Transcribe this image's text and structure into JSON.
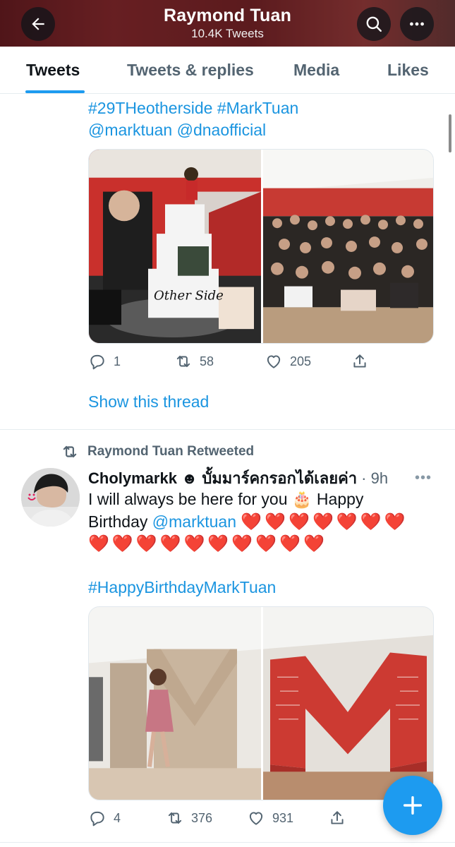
{
  "header": {
    "title": "Raymond Tuan",
    "subtitle": "10.4K Tweets",
    "back_icon": "back-arrow-icon",
    "search_icon": "search-icon",
    "more_icon": "more-icon"
  },
  "tabs": [
    {
      "label": "Tweets",
      "active": true
    },
    {
      "label": "Tweets & replies",
      "active": false
    },
    {
      "label": "Media",
      "active": false
    },
    {
      "label": "Likes",
      "active": false
    }
  ],
  "tweet1": {
    "hashtags_line": "#29THeotherside #MarkTuan",
    "mentions_line": "@marktuan @dnaofficial",
    "actions": {
      "reply": "1",
      "retweet": "58",
      "like": "205"
    },
    "show_thread": "Show this thread"
  },
  "tweet2": {
    "retweeted_by": "Raymond Tuan Retweeted",
    "display_name": "Cholymarkk ☻ บั้มมาร์คกรอกได้เลยค่า",
    "time": "· 9h",
    "line1": "I will always be here for you 🎂  Happy",
    "line2_prefix": "Birthday ",
    "mention": "@marktuan",
    "hearts_line2": "❤️❤️❤️❤️❤️❤️❤️",
    "hearts_line3": "❤️❤️❤️❤️❤️❤️❤️❤️❤️❤️",
    "hashtag": "#HappyBirthdayMarkTuan",
    "actions": {
      "reply": "4",
      "retweet": "376",
      "like": "931"
    }
  },
  "fab": {
    "icon": "compose-plus-icon"
  },
  "colors": {
    "accent": "#1d9bf0",
    "text": "#0f1419",
    "muted": "#536471",
    "heart": "#e0245e"
  }
}
